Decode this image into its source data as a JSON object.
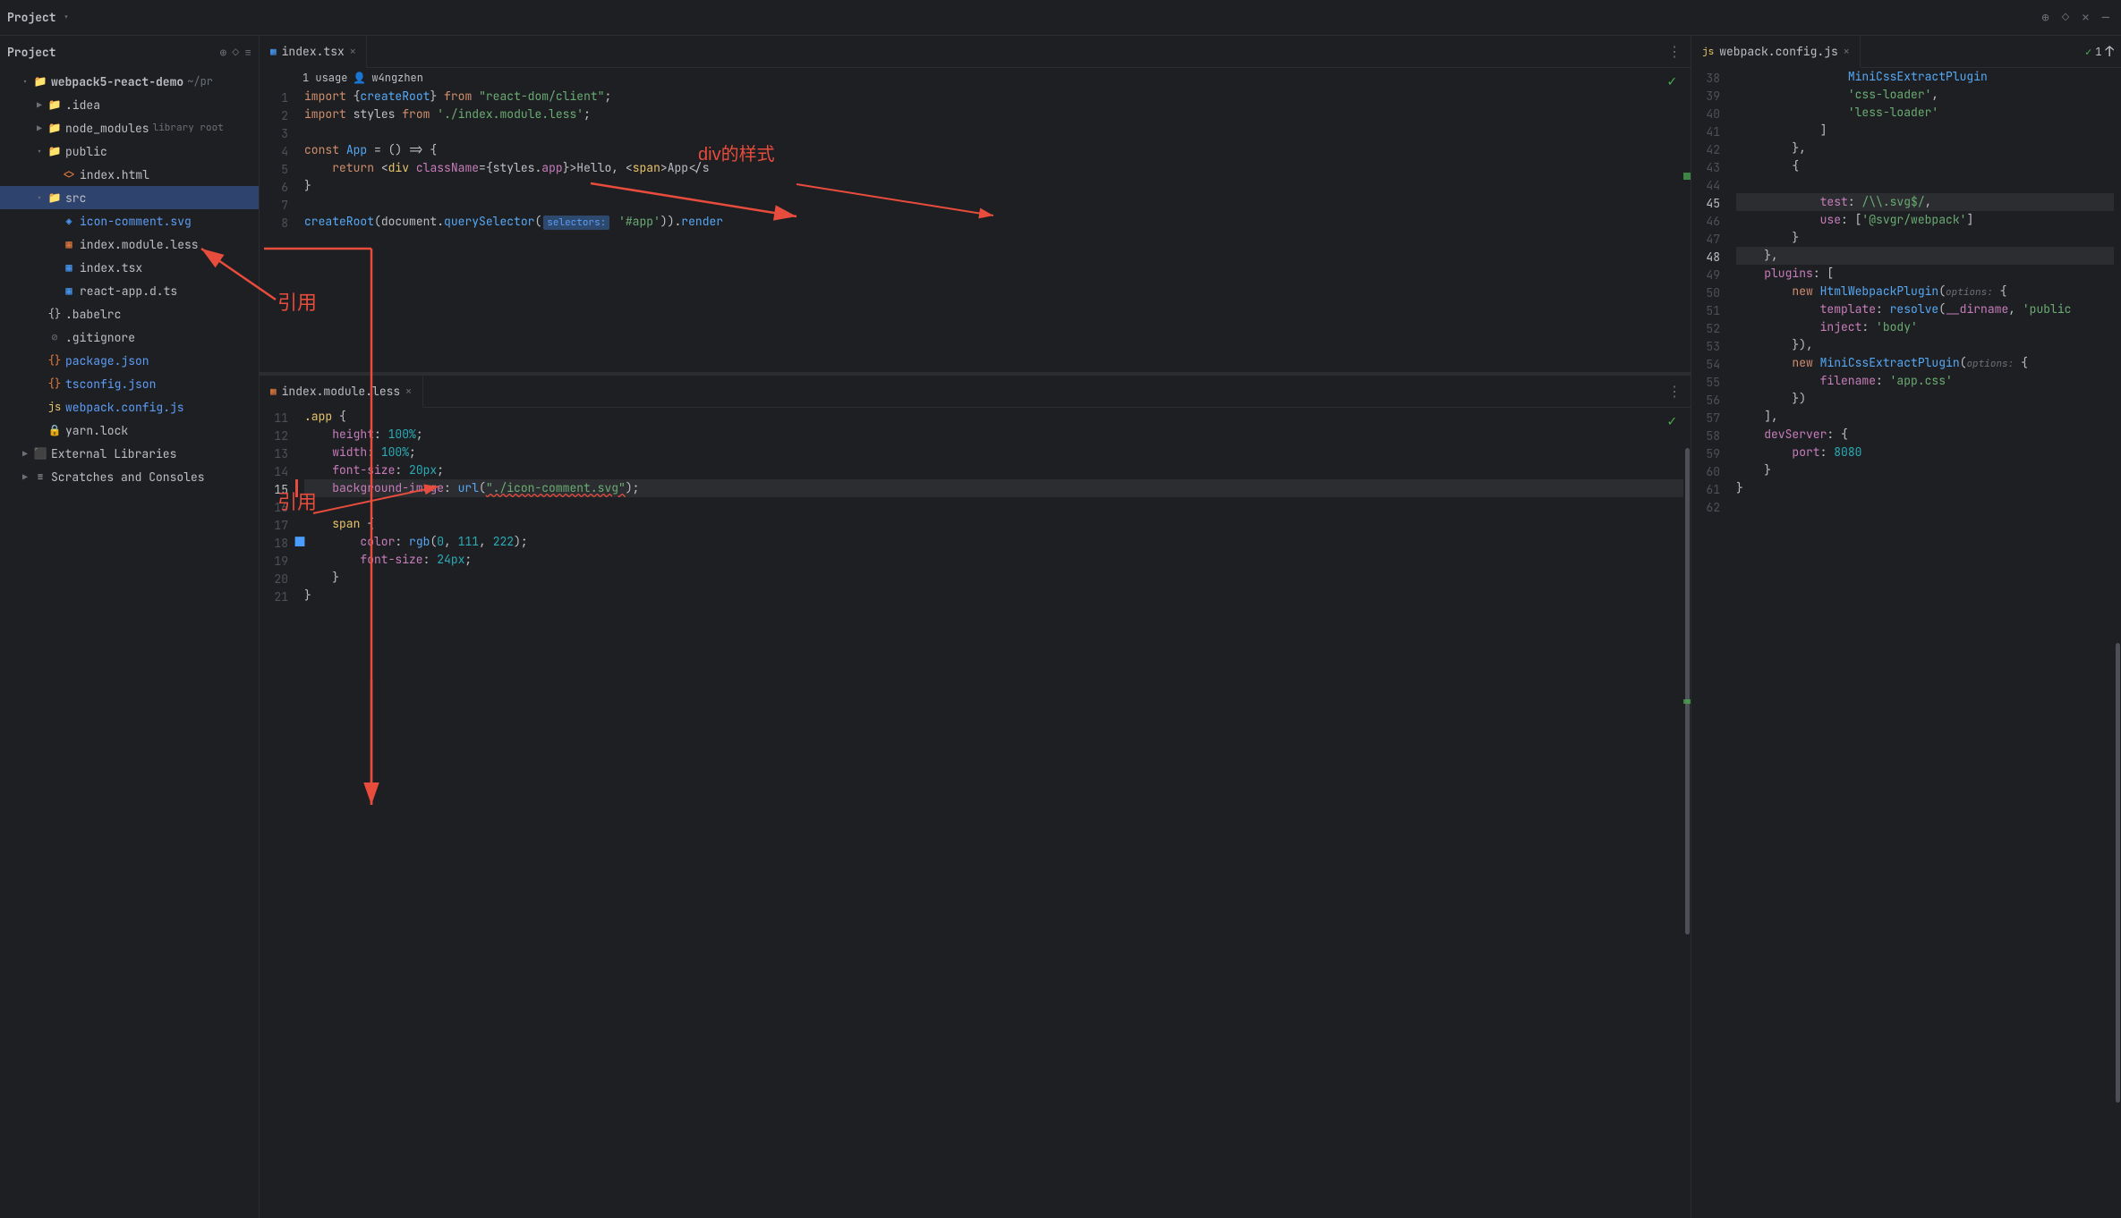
{
  "topbar": {
    "title": "Project",
    "icons": [
      "⊕",
      "◇",
      "✕",
      "—"
    ]
  },
  "sidebar": {
    "title": "Project",
    "items": [
      {
        "level": 1,
        "label": "webpack5-react-demo",
        "suffix": "~/pr",
        "type": "folder",
        "expanded": true,
        "bold": true
      },
      {
        "level": 2,
        "label": ".idea",
        "type": "folder",
        "expanded": false
      },
      {
        "level": 2,
        "label": "node_modules",
        "suffix": "library root",
        "type": "folder",
        "expanded": false
      },
      {
        "level": 2,
        "label": "public",
        "type": "folder",
        "expanded": true
      },
      {
        "level": 3,
        "label": "index.html",
        "type": "html"
      },
      {
        "level": 2,
        "label": "src",
        "type": "folder",
        "expanded": true,
        "selected": true
      },
      {
        "level": 3,
        "label": "icon-comment.svg",
        "type": "svg"
      },
      {
        "level": 3,
        "label": "index.module.less",
        "type": "less"
      },
      {
        "level": 3,
        "label": "index.tsx",
        "type": "tsx"
      },
      {
        "level": 3,
        "label": "react-app.d.ts",
        "type": "ts"
      },
      {
        "level": 2,
        "label": ".babelrc",
        "type": "babelrc"
      },
      {
        "level": 2,
        "label": ".gitignore",
        "type": "gitignore"
      },
      {
        "level": 2,
        "label": "package.json",
        "type": "json"
      },
      {
        "level": 2,
        "label": "tsconfig.json",
        "type": "json"
      },
      {
        "level": 2,
        "label": "webpack.config.js",
        "type": "js"
      },
      {
        "level": 2,
        "label": "yarn.lock",
        "type": "yarn"
      },
      {
        "level": 1,
        "label": "External Libraries",
        "type": "library",
        "expanded": false
      },
      {
        "level": 1,
        "label": "Scratches and Consoles",
        "type": "scratches",
        "expanded": false
      }
    ]
  },
  "editor": {
    "tabs_left": [
      {
        "label": "index.tsx",
        "type": "tsx",
        "active": true,
        "closable": true
      },
      {
        "label": "index.module.less",
        "type": "less",
        "active": false,
        "closable": true
      }
    ],
    "tab_right": [
      {
        "label": "webpack.config.js",
        "type": "js",
        "active": true,
        "closable": true
      }
    ],
    "index_tsx": {
      "lines": [
        {
          "n": 1,
          "code": "import {createRoot} from \"react-dom/client\";",
          "gutter": ""
        },
        {
          "n": 2,
          "code": "import styles from './index.module.less';",
          "gutter": ""
        },
        {
          "n": 3,
          "code": "",
          "gutter": ""
        },
        {
          "n": 4,
          "code": "const App = () => {",
          "gutter": ""
        },
        {
          "n": 5,
          "code": "    return <div className={styles.app}>Hello, <span>App</s",
          "gutter": ""
        },
        {
          "n": 6,
          "code": "}",
          "gutter": ""
        },
        {
          "n": 7,
          "code": "",
          "gutter": ""
        },
        {
          "n": 8,
          "code": "createRoot(document.querySelector( selectors: '#app')).render",
          "gutter": ""
        }
      ],
      "usage_text": "1 usage",
      "usage_author": "w4ngzhen"
    },
    "index_module_less": {
      "lines": [
        {
          "n": 11,
          "code": ".app {",
          "gutter": ""
        },
        {
          "n": 12,
          "code": "    height: 100%;",
          "gutter": ""
        },
        {
          "n": 13,
          "code": "    width: 100%;",
          "gutter": ""
        },
        {
          "n": 14,
          "code": "    font-size: 20px;",
          "gutter": ""
        },
        {
          "n": 15,
          "code": "    background-image: url(\"./icon-comment.svg\");",
          "gutter": "red",
          "highlighted": true
        },
        {
          "n": 16,
          "code": "",
          "gutter": ""
        },
        {
          "n": 17,
          "code": "",
          "gutter": ""
        },
        {
          "n": 18,
          "code": "    color: rgb(0, 111, 222);",
          "gutter": "blue"
        },
        {
          "n": 19,
          "code": "    font-size: 24px;",
          "gutter": ""
        },
        {
          "n": 20,
          "code": "}",
          "gutter": ""
        },
        {
          "n": 21,
          "code": "}",
          "gutter": ""
        }
      ],
      "span_line": "    span {"
    },
    "webpack_config": {
      "lines": [
        {
          "n": 38,
          "code": "                MiniCssExtractPlugin"
        },
        {
          "n": 39,
          "code": "                'css-loader',"
        },
        {
          "n": 40,
          "code": "                'less-loader'"
        },
        {
          "n": 41,
          "code": "            ]"
        },
        {
          "n": 42,
          "code": "        },"
        },
        {
          "n": 43,
          "code": "        {"
        },
        {
          "n": 44,
          "code": ""
        },
        {
          "n": 45,
          "code": "            test: /\\.svg$/,"
        },
        {
          "n": 46,
          "code": "            use: ['@svgr/webpack']"
        },
        {
          "n": 47,
          "code": "        }"
        },
        {
          "n": 48,
          "code": "    },"
        },
        {
          "n": 49,
          "code": "    plugins: ["
        },
        {
          "n": 50,
          "code": "        new HtmlWebpackPlugin( options: {"
        },
        {
          "n": 51,
          "code": "            template: resolve(__dirname, 'public"
        },
        {
          "n": 52,
          "code": "            inject: 'body'"
        },
        {
          "n": 53,
          "code": "        }),"
        },
        {
          "n": 54,
          "code": "        new MiniCssExtractPlugin( options: {"
        },
        {
          "n": 55,
          "code": "            filename: 'app.css'"
        },
        {
          "n": 56,
          "code": "        })"
        },
        {
          "n": 57,
          "code": "    ],"
        },
        {
          "n": 58,
          "code": "    devServer: {"
        },
        {
          "n": 59,
          "code": "        port: 8080"
        },
        {
          "n": 60,
          "code": "    }"
        },
        {
          "n": 61,
          "code": "}"
        }
      ]
    }
  },
  "annotations": {
    "div_label": "div的样式",
    "ref_label": "引用"
  },
  "colors": {
    "background": "#1e1f22",
    "sidebar_bg": "#1e1f22",
    "tab_active": "#1e1f22",
    "tab_inactive": "#2b2d30",
    "selected_folder": "#2e436e",
    "line_highlight": "#2b2d30",
    "accent_green": "#4caf50",
    "accent_blue": "#4a9eff",
    "accent_red": "#e74c3c",
    "border": "#2b2d30"
  }
}
